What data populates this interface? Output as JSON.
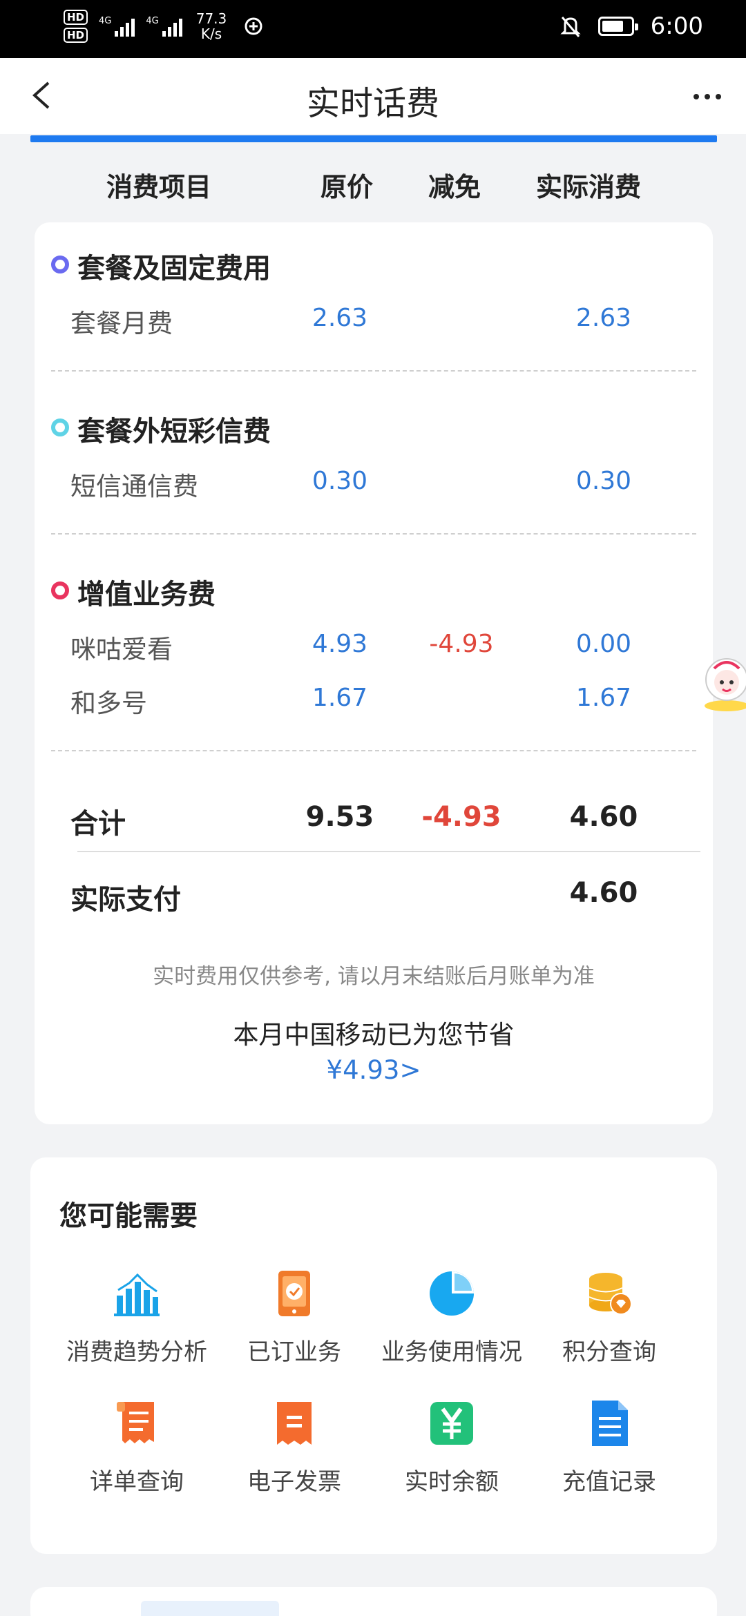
{
  "status_bar": {
    "sim1": "HD",
    "sim2": "HD",
    "net1": "4G",
    "net2": "4G",
    "speed_value": "77.3",
    "speed_unit": "K/s",
    "time": "6:00"
  },
  "header": {
    "title": "实时话费"
  },
  "columns": [
    "消费项目",
    "原价",
    "减免",
    "实际消费"
  ],
  "sections": [
    {
      "title": "套餐及固定费用",
      "dot_color": "#6a6af0",
      "rows": [
        {
          "name": "套餐月费",
          "original": "2.63",
          "discount": "",
          "actual": "2.63"
        }
      ]
    },
    {
      "title": "套餐外短彩信费",
      "dot_color": "#5fd3e6",
      "rows": [
        {
          "name": "短信通信费",
          "original": "0.30",
          "discount": "",
          "actual": "0.30"
        }
      ]
    },
    {
      "title": "增值业务费",
      "dot_color": "#e9345f",
      "rows": [
        {
          "name": "咪咕爱看",
          "original": "4.93",
          "discount": "-4.93",
          "actual": "0.00"
        },
        {
          "name": "和多号",
          "original": "1.67",
          "discount": "",
          "actual": "1.67"
        }
      ]
    }
  ],
  "total": {
    "label": "合计",
    "original": "9.53",
    "discount": "-4.93",
    "actual": "4.60"
  },
  "paid": {
    "label": "实际支付",
    "actual": "4.60"
  },
  "note": "实时费用仅供参考, 请以月末结账后月账单为准",
  "saving": {
    "text": "本月中国移动已为您节省",
    "link": "¥4.93>"
  },
  "recommend": {
    "title": "您可能需要",
    "items": [
      {
        "label": "消费趋势分析",
        "icon": "bar-chart-icon"
      },
      {
        "label": "已订业务",
        "icon": "subscribed-icon"
      },
      {
        "label": "业务使用情况",
        "icon": "pie-chart-icon"
      },
      {
        "label": "积分查询",
        "icon": "points-icon"
      },
      {
        "label": "详单查询",
        "icon": "receipt-icon"
      },
      {
        "label": "电子发票",
        "icon": "invoice-icon"
      },
      {
        "label": "实时余额",
        "icon": "balance-icon"
      },
      {
        "label": "充值记录",
        "icon": "document-icon"
      }
    ]
  }
}
